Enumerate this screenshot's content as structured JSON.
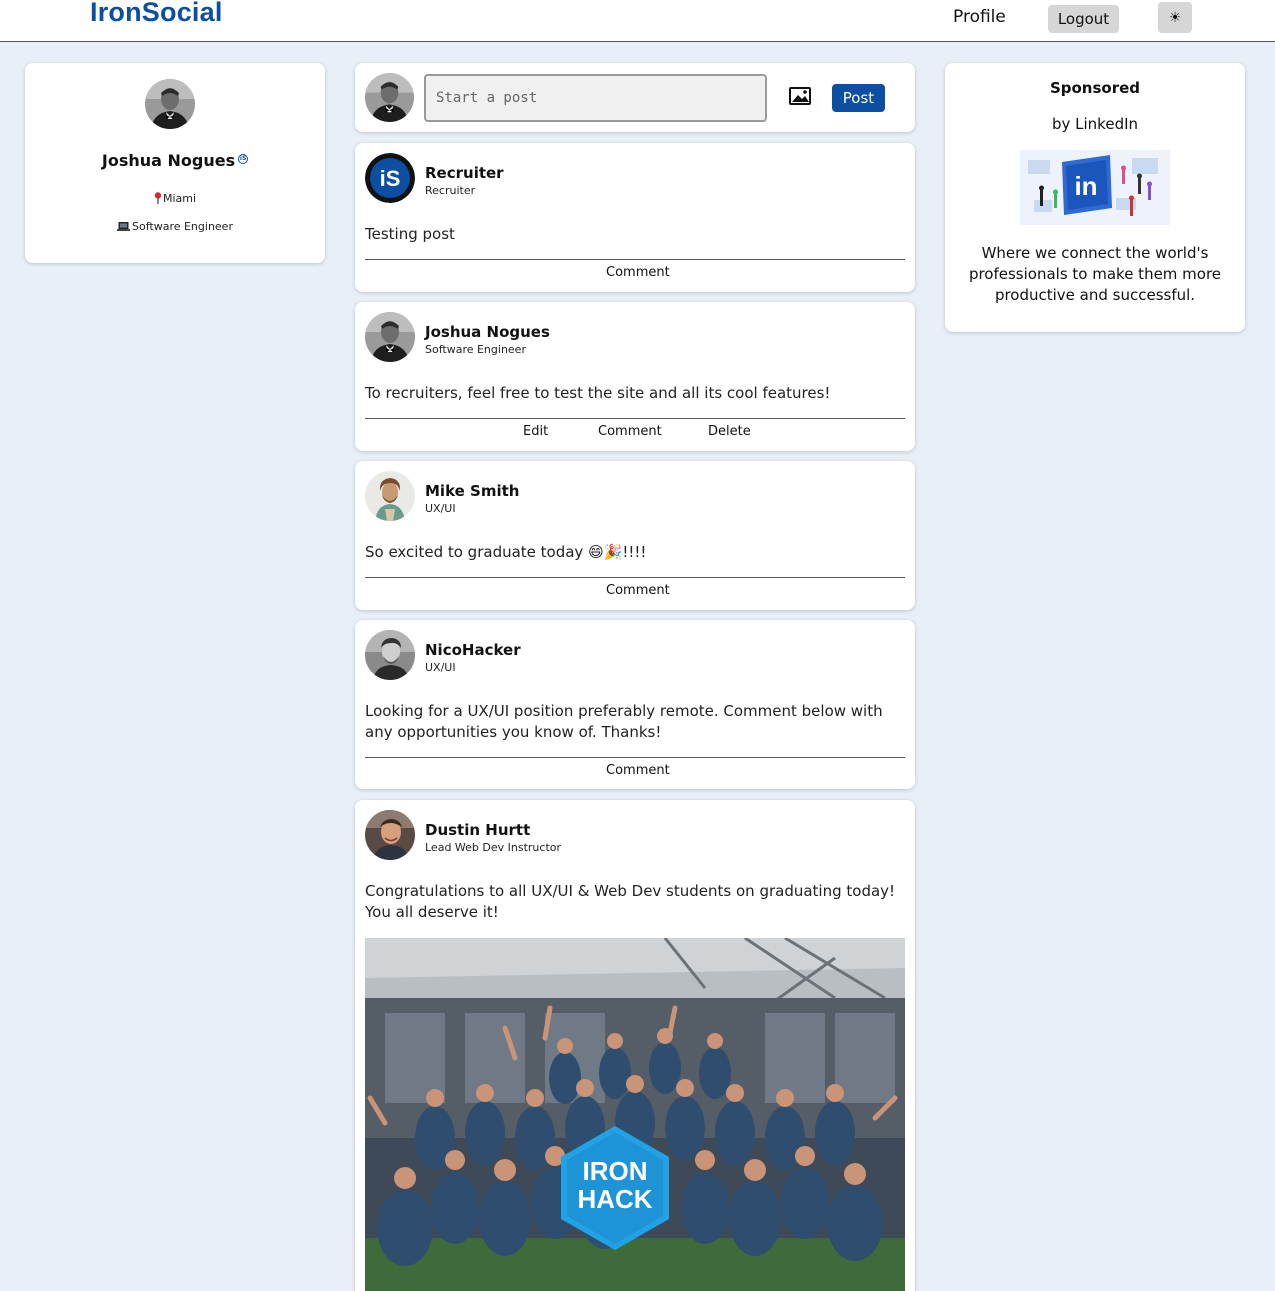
{
  "navbar": {
    "brand": "IronSocial",
    "profile_label": "Profile",
    "logout_label": "Logout",
    "theme_toggle_label": "☀"
  },
  "profile": {
    "name": "Joshua Nogues",
    "location": "Miami",
    "title": "Software Engineer"
  },
  "composer": {
    "placeholder": "Start a post",
    "post_label": "Post"
  },
  "posts": [
    {
      "author": "Recruiter",
      "role": "Recruiter",
      "body": "Testing post",
      "actions": [
        "Comment"
      ]
    },
    {
      "author": "Joshua Nogues",
      "role": "Software Engineer",
      "body": "To recruiters, feel free to test the site and all its cool features!",
      "actions": [
        "Edit",
        "Comment",
        "Delete"
      ]
    },
    {
      "author": "Mike Smith",
      "role": "UX/UI",
      "body": "So excited to graduate today 😄🎉!!!!",
      "actions": [
        "Comment"
      ]
    },
    {
      "author": "NicoHacker",
      "role": "UX/UI",
      "body": "Looking for a UX/UI position preferably remote. Comment below with any opportunities you know of. Thanks!",
      "actions": [
        "Comment"
      ]
    },
    {
      "author": "Dustin Hurtt",
      "role": "Lead Web Dev Instructor",
      "body": "Congratulations to all UX/UI & Web Dev students on graduating today! You all deserve it!",
      "photo_badge": "IRON HACK"
    }
  ],
  "sponsored": {
    "title": "Sponsored",
    "by": "by LinkedIn",
    "logo_text": "in",
    "text": "Where we connect the world's professionals to make them more productive and successful."
  },
  "colors": {
    "brand": "#0b4ea2",
    "background": "#e8eff7",
    "button_gray": "#d6d6d6"
  }
}
